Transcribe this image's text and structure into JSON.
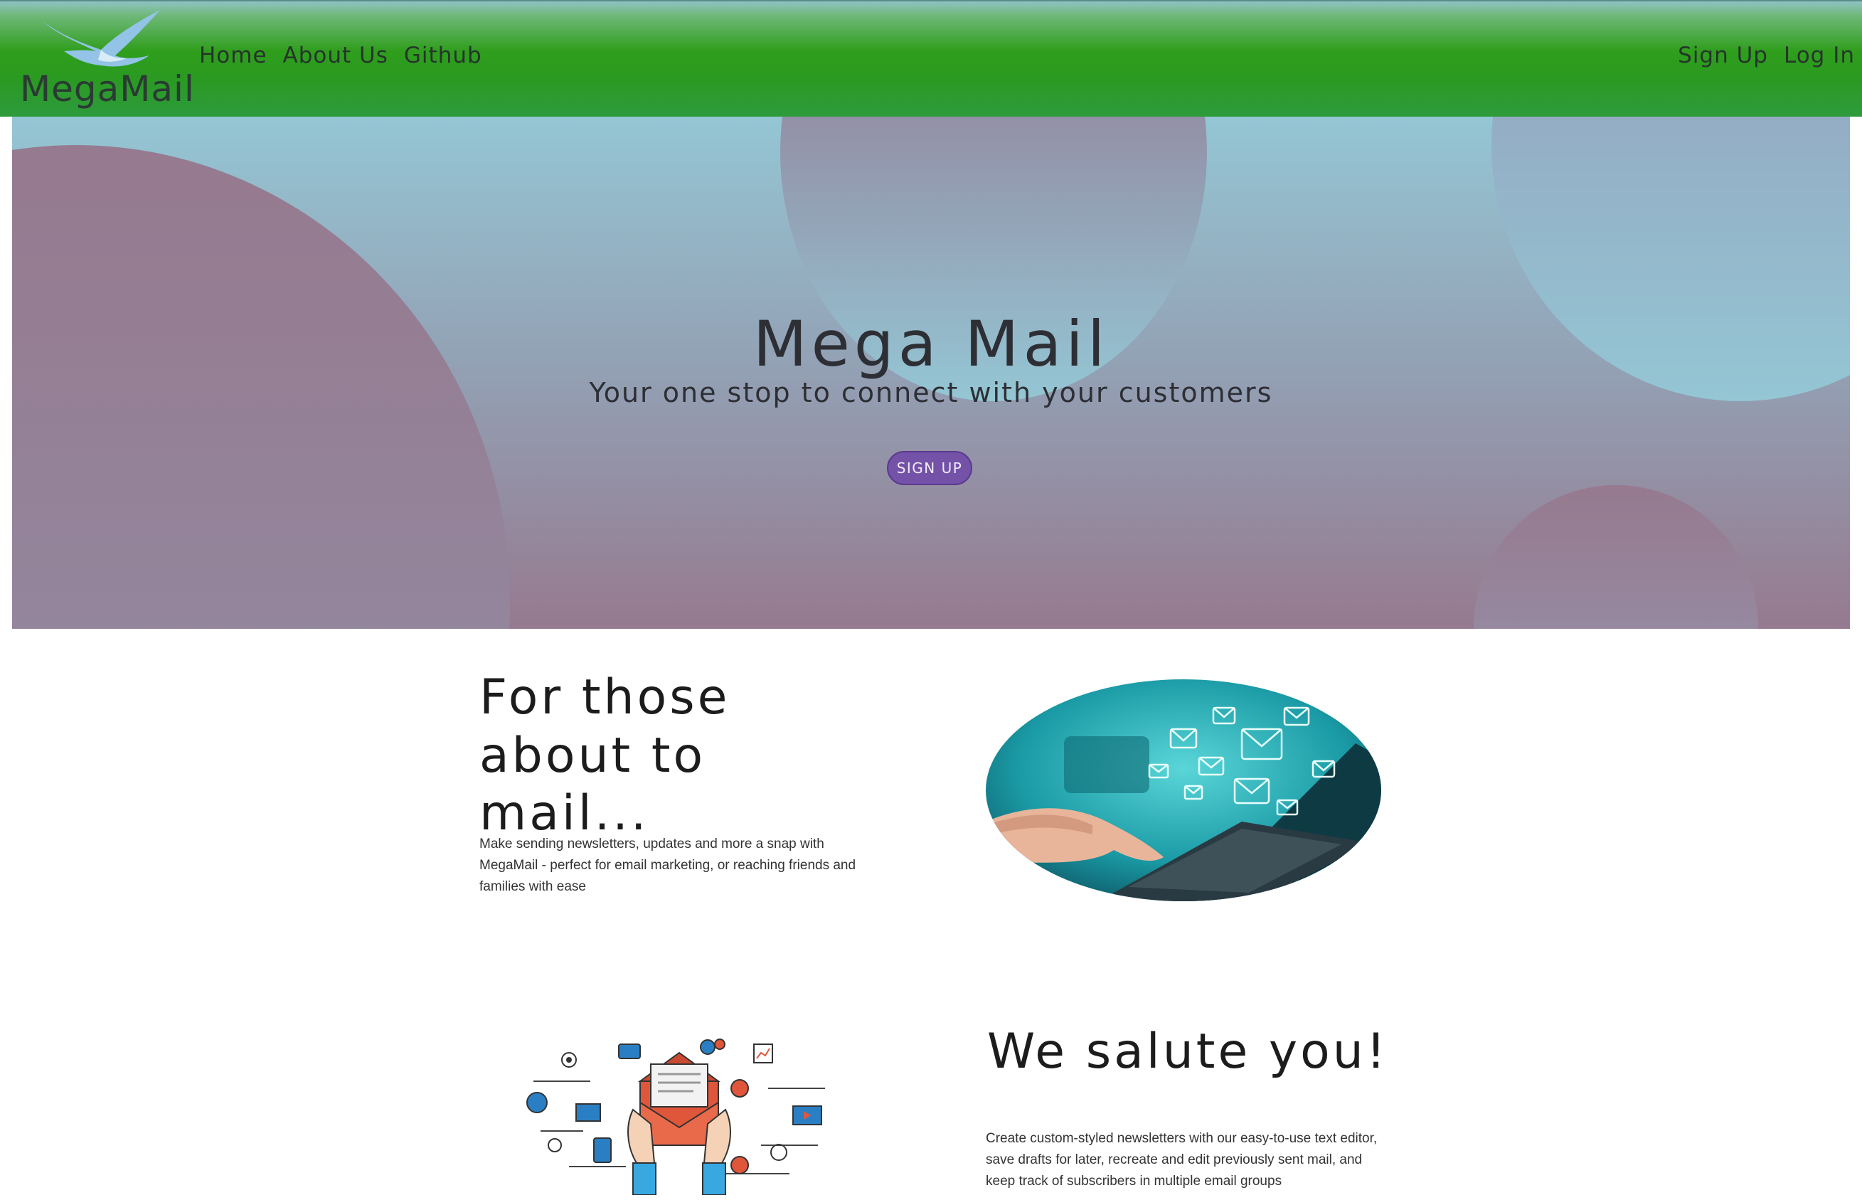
{
  "navbar": {
    "brand": "MegaMail",
    "links_left": [
      "Home",
      "About Us",
      "Github"
    ],
    "links_right": [
      "Sign Up",
      "Log In"
    ]
  },
  "hero": {
    "title": "Mega Mail",
    "subtitle": "Your one stop to connect with your customers",
    "button_label": "SIGN UP"
  },
  "feature1": {
    "heading": "For those about to mail...",
    "text": "Make sending newsletters, updates and more a snap with MegaMail - perfect for email marketing, or reaching friends and families with ease"
  },
  "feature2": {
    "heading": "We salute you!",
    "text": "Create custom-styled newsletters with our easy-to-use text editor, save drafts for later, recreate and edit previously sent mail, and keep track of subscribers in multiple email groups"
  },
  "colors": {
    "navbar": "#2f9e1c",
    "hero_blue": "#94c6d4",
    "hero_mauve": "#967a8f",
    "button": "#7352a8"
  }
}
